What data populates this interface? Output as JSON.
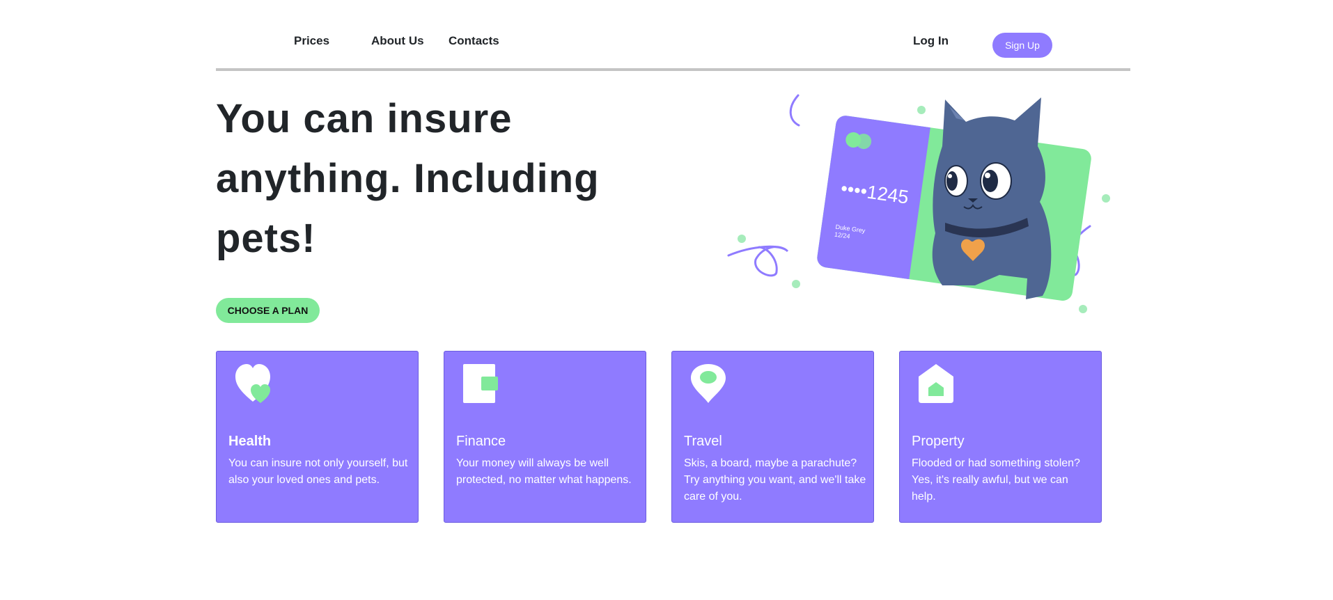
{
  "nav": {
    "links": [
      {
        "label": "Prices"
      },
      {
        "label": "About Us"
      },
      {
        "label": "Contacts"
      }
    ],
    "login_label": "Log In",
    "signup_label": "Sign Up"
  },
  "hero": {
    "title": "You can insure anything. Including pets!",
    "cta_label": "CHOOSE A PLAN",
    "card_number": "••••1245",
    "card_holder": "Duke Grey",
    "card_expiry": "12/24"
  },
  "features": [
    {
      "icon": "heart-icon",
      "title": "Health",
      "text": "You can insure not only yourself, but also your loved ones and pets."
    },
    {
      "icon": "wallet-icon",
      "title": "Finance",
      "text": "Your money will always be well protected, no matter what happens."
    },
    {
      "icon": "map-pin-icon",
      "title": "Travel",
      "text": "Skis, a board, maybe a parachute? Try anything you want, and we'll take care of you."
    },
    {
      "icon": "house-icon",
      "title": "Property",
      "text": "Flooded or had something stolen? Yes, it's really awful, but we can help."
    }
  ],
  "colors": {
    "accent_purple": "#8f7bff",
    "accent_green": "#81e99a",
    "text_dark": "#212529",
    "divider": "#c4c4c4"
  }
}
